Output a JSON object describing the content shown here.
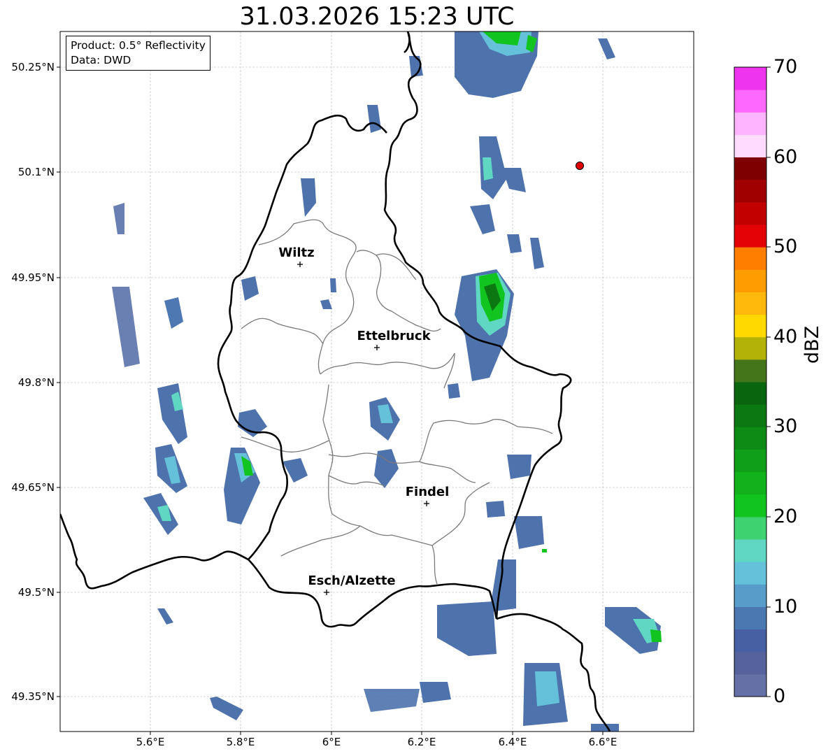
{
  "title": "31.03.2026 15:23 UTC",
  "info": {
    "product": "Product: 0.5° Reflectivity",
    "source": "Data: DWD"
  },
  "axes": {
    "y_ticks": [
      "50.25°N",
      "50.1°N",
      "49.95°N",
      "49.8°N",
      "49.65°N",
      "49.5°N",
      "49.35°N"
    ],
    "x_ticks": [
      "5.6°E",
      "5.8°E",
      "6°E",
      "6.2°E",
      "6.4°E",
      "6.6°E"
    ]
  },
  "cities": [
    {
      "name": "Wiltz"
    },
    {
      "name": "Ettelbruck"
    },
    {
      "name": "Findel"
    },
    {
      "name": "Esch/Alzette"
    }
  ],
  "radar_site_color": "#e00000",
  "colorbar": {
    "label": "dBZ",
    "ticks": [
      "70",
      "60",
      "50",
      "40",
      "30",
      "20",
      "10",
      "0"
    ],
    "colors": [
      "#6470a6",
      "#55629b",
      "#4660a3",
      "#4b78b0",
      "#589dca",
      "#65c0d9",
      "#5fd7c3",
      "#3ed271",
      "#12c41f",
      "#11b21b",
      "#109f18",
      "#0e8b15",
      "#0b7811",
      "#0a650f",
      "#44751b",
      "#b3b209",
      "#ffd900",
      "#ffb80b",
      "#ff9d00",
      "#ff7e00",
      "#e30306",
      "#c30000",
      "#a10000",
      "#7f0000",
      "#ffdcff",
      "#ffb4ff",
      "#ff68ff",
      "#ee34ee"
    ]
  }
}
